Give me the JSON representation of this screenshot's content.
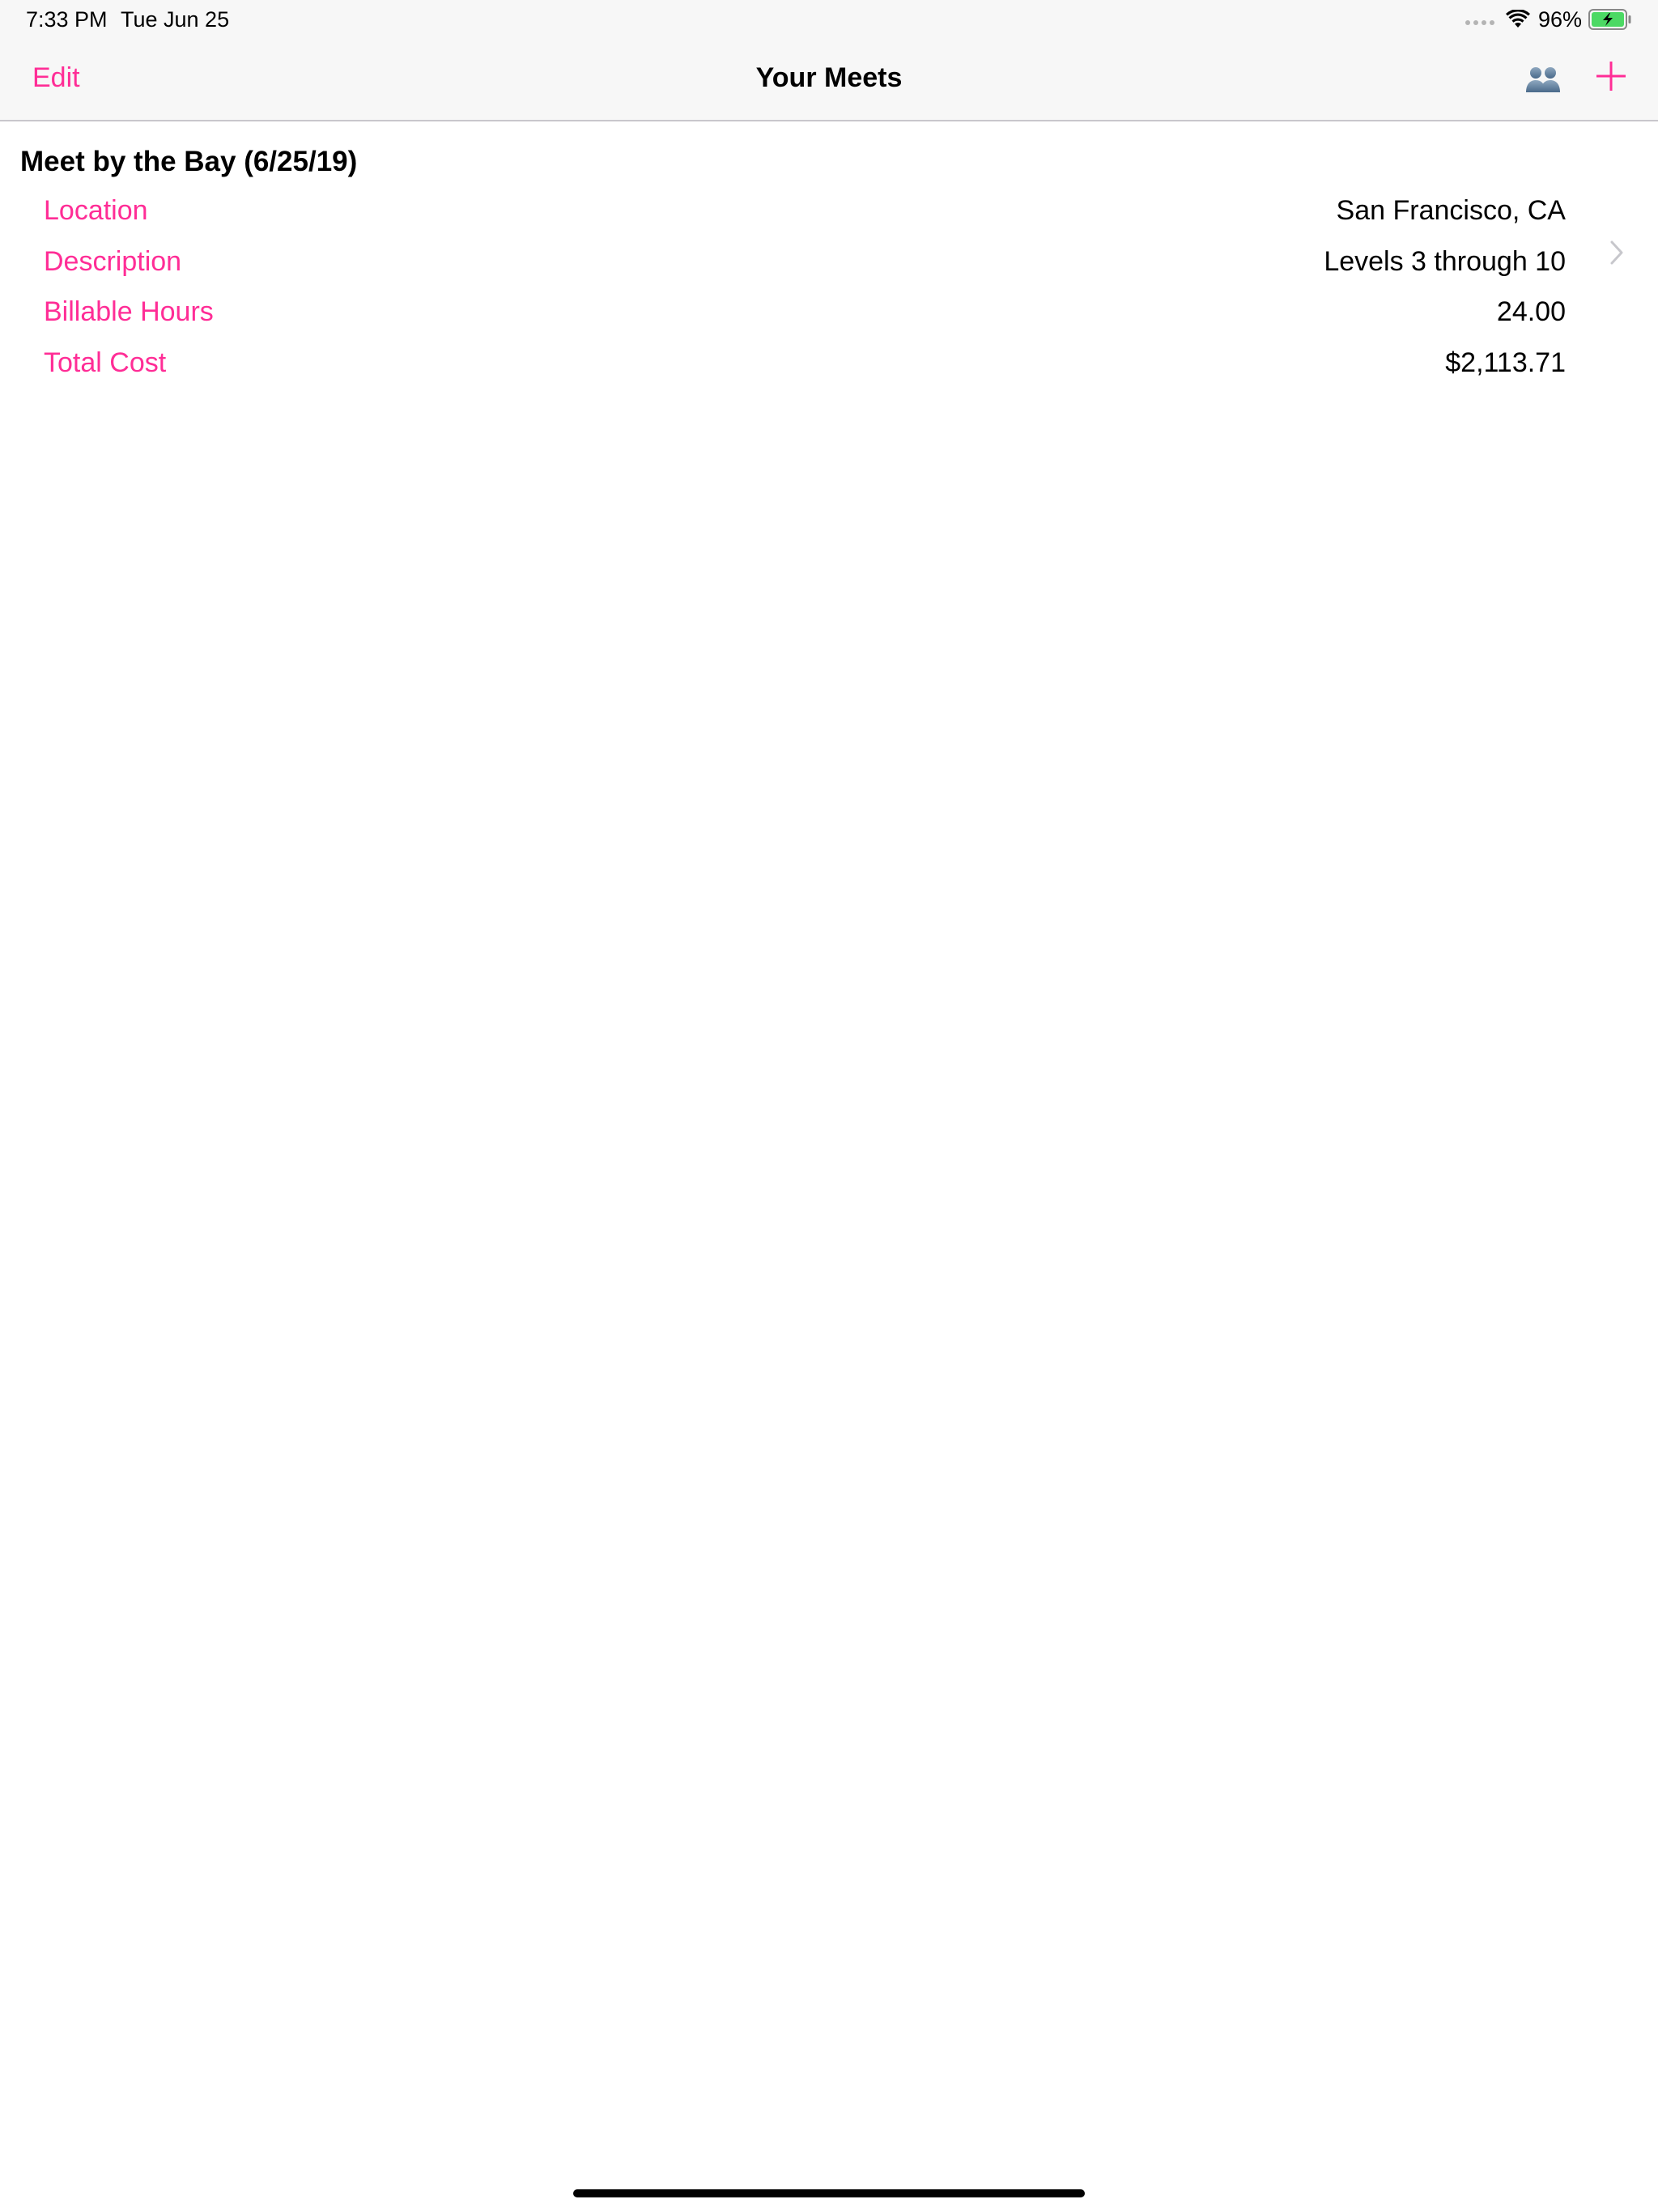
{
  "status_bar": {
    "time": "7:33 PM",
    "date": "Tue Jun 25",
    "battery_percent": "96%",
    "icons": [
      "cellular-signal-icon",
      "wifi-icon",
      "battery-charging-icon"
    ]
  },
  "nav_bar": {
    "edit_label": "Edit",
    "title": "Your Meets",
    "right_icons": [
      "people-icon",
      "add-icon"
    ]
  },
  "colors": {
    "accent": "#ff2d96",
    "bar_background": "#f7f7f7",
    "chevron": "#c7c7cc"
  },
  "meets": [
    {
      "title": "Meet by the Bay (6/25/19)",
      "details": [
        {
          "label": "Location",
          "value": "San Francisco, CA"
        },
        {
          "label": "Description",
          "value": "Levels 3 through 10"
        },
        {
          "label": "Billable Hours",
          "value": "24.00"
        },
        {
          "label": "Total Cost",
          "value": "$2,113.71"
        }
      ]
    }
  ]
}
